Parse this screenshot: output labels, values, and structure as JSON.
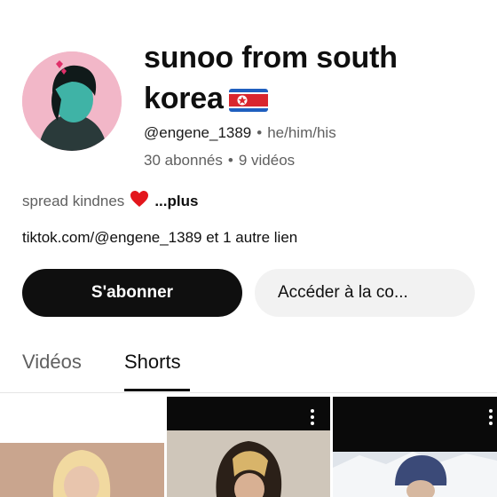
{
  "channel": {
    "name": "sunoo from south korea",
    "handle": "@engene_1389",
    "pronouns": "he/him/his",
    "subscribers": "30 abonnés",
    "videos_count": "9 vidéos",
    "separator": "•",
    "description": "spread kindnes",
    "more_label": "...plus",
    "links": "tiktok.com/@engene_1389 et 1 autre lien"
  },
  "buttons": {
    "subscribe": "S'abonner",
    "join": "Accéder à la co..."
  },
  "tabs": [
    {
      "label": "Vidéos",
      "active": false
    },
    {
      "label": "Shorts",
      "active": true
    }
  ],
  "icons": {
    "heart": "red-heart-icon",
    "flag": "north-korea-flag-icon",
    "menu": "more-vert-icon"
  },
  "colors": {
    "subscribe_bg": "#0f0f0f",
    "secondary_text": "#606060",
    "avatar_bg": "#f2b7c8"
  }
}
